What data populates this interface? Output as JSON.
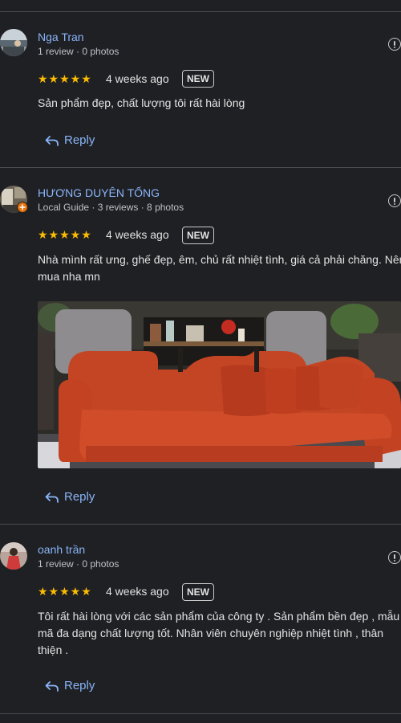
{
  "reviews": [
    {
      "name": "Nga Tran",
      "meta": "1 review · 0 photos",
      "stars": "★★★★★",
      "time": "4 weeks ago",
      "badge": "NEW",
      "text": "Sản phẩm đẹp, chất lượng tôi rất hài lòng",
      "reply_label": "Reply"
    },
    {
      "name": "HƯƠNG DUYÊN TỐNG",
      "meta": "Local Guide · 3 reviews · 8 photos",
      "stars": "★★★★★",
      "time": "4 weeks ago",
      "badge": "NEW",
      "text": "Nhà mình rất ưng, ghế đẹp, êm, chủ rất nhiệt tình, giá cả phải chăng. Nên mua nha mn",
      "reply_label": "Reply"
    },
    {
      "name": "oanh trần",
      "meta": "1 review · 0 photos",
      "stars": "★★★★★",
      "time": "4 weeks ago",
      "badge": "NEW",
      "text": "Tôi rất hài lòng với các sản phẩm của công ty . Sản phẩm bền đẹp , mẫu mã đa dạng chất lượng tốt. Nhân viên chuyên nghiệp nhiệt tình , thân thiện .",
      "reply_label": "Reply"
    }
  ],
  "colors": {
    "background": "#1f2024",
    "link": "#8ab4f8",
    "star": "#fbbc04",
    "divider": "#4a4b50"
  },
  "icons": {
    "more": "info-circle-icon",
    "reply": "reply-arrow-icon",
    "local_guide": "local-guide-badge-icon"
  }
}
